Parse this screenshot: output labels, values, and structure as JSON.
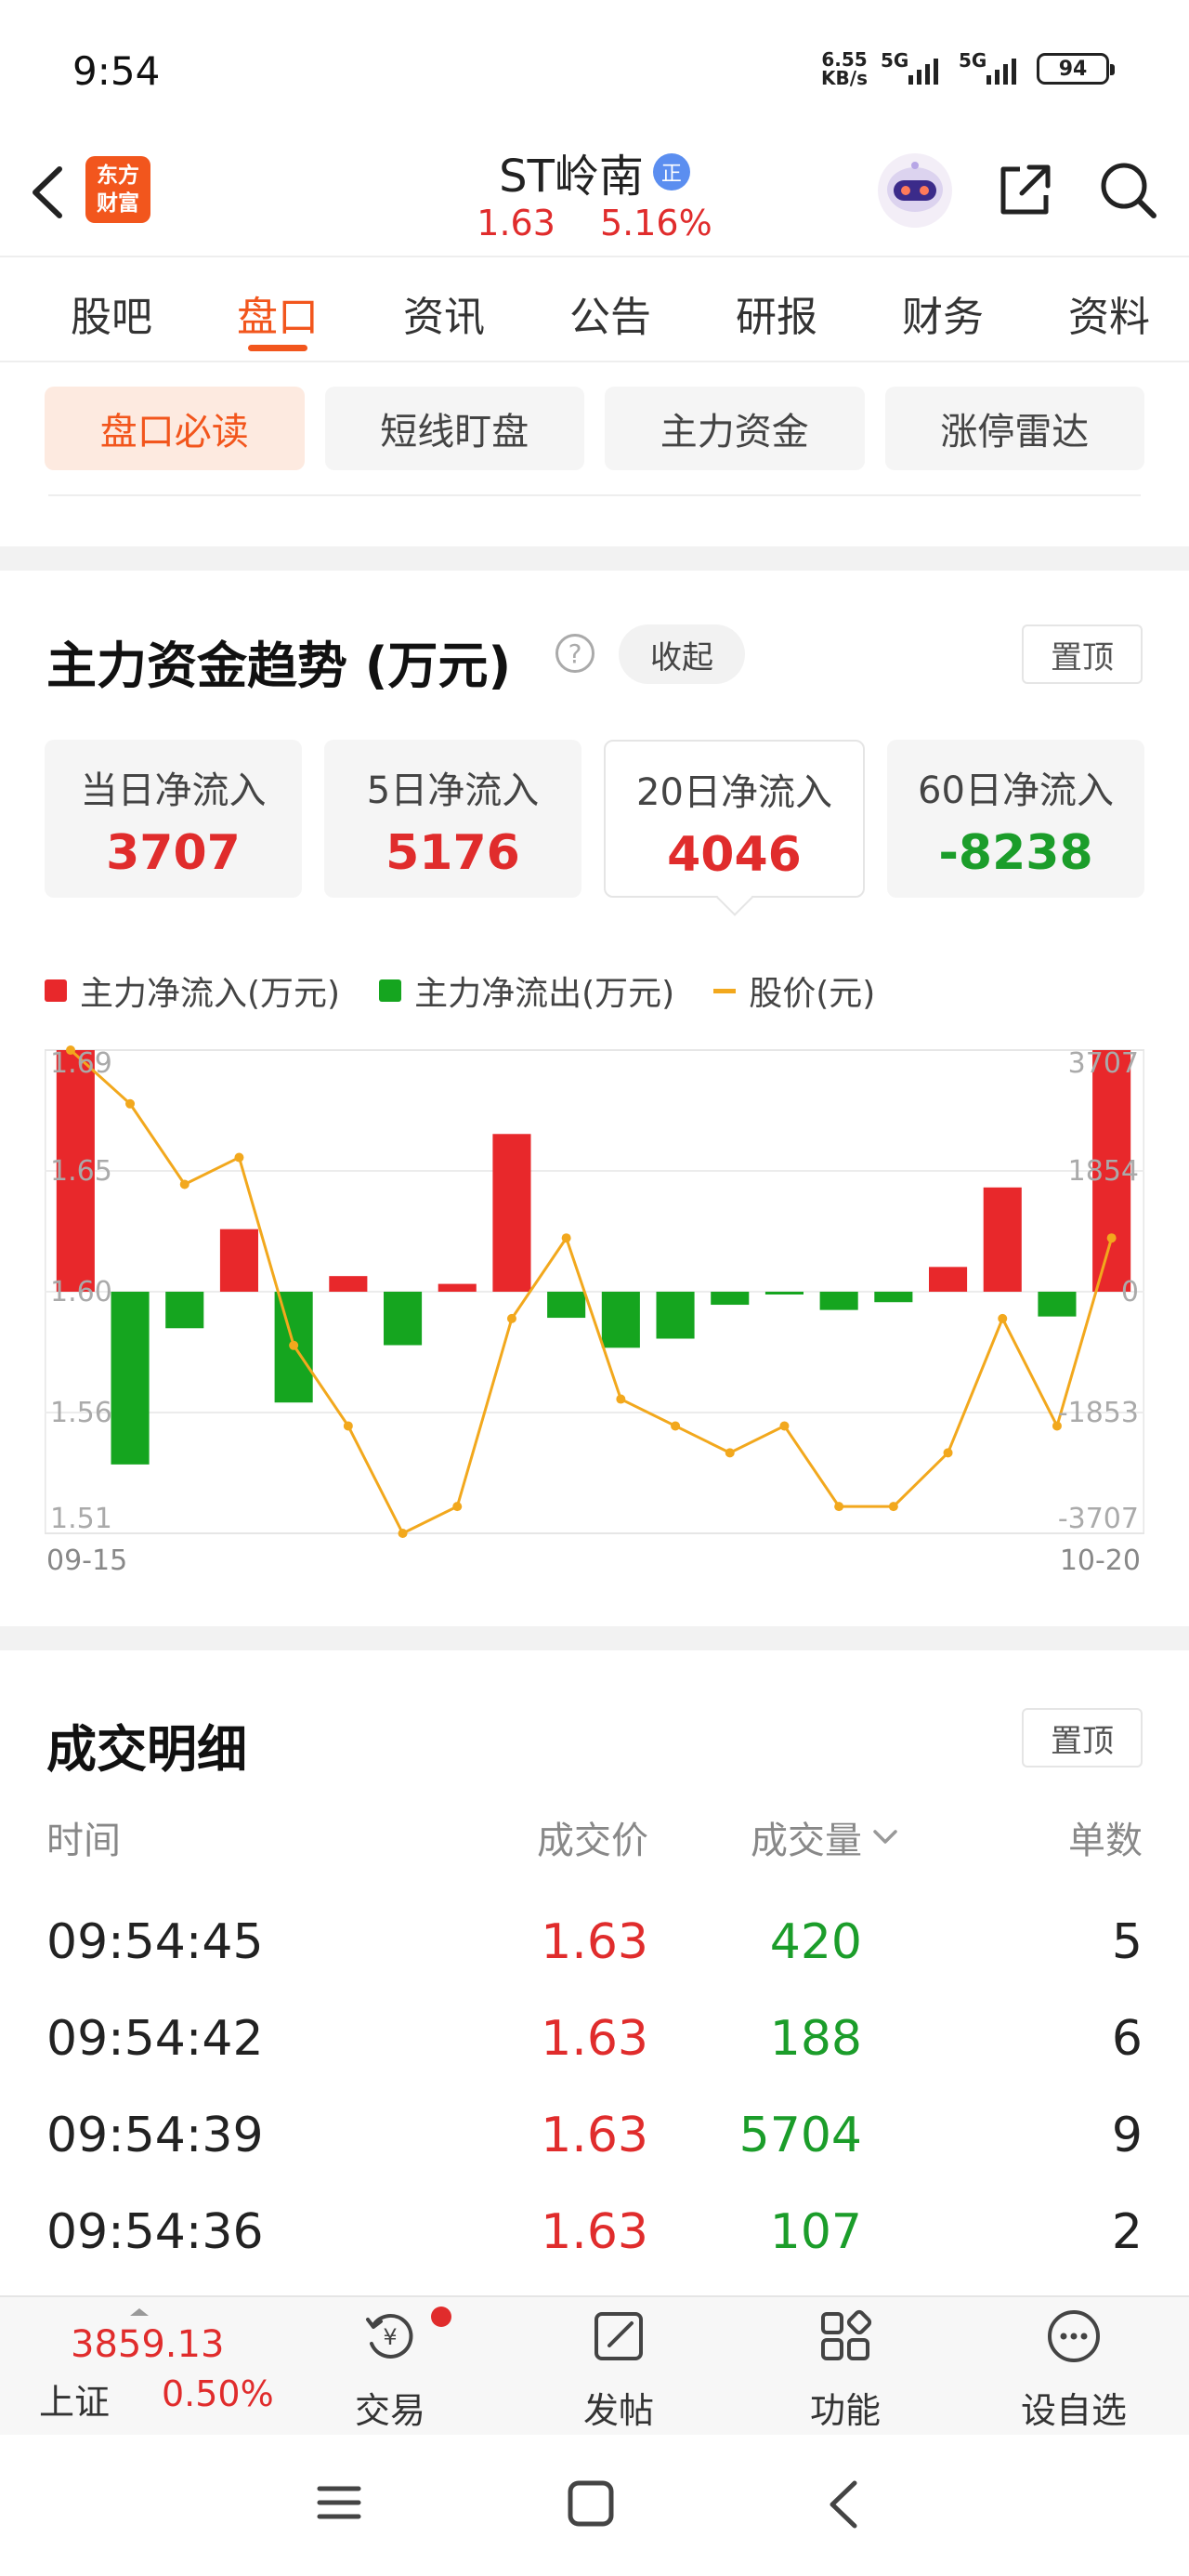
{
  "status_bar": {
    "time": "9:54",
    "net_speed_value": "6.55",
    "net_speed_unit": "KB/s",
    "signal1": "5G",
    "signal2": "5G",
    "battery": "94"
  },
  "header": {
    "logo_line1": "东方",
    "logo_line2": "财富",
    "stock_name": "ST岭南",
    "badge": "正",
    "price": "1.63",
    "change_pct": "5.16%"
  },
  "tabs": [
    "股吧",
    "盘口",
    "资讯",
    "公告",
    "研报",
    "财务",
    "资料"
  ],
  "active_tab": "盘口",
  "subtabs": [
    "盘口必读",
    "短线盯盘",
    "主力资金",
    "涨停雷达"
  ],
  "fund_trend": {
    "title": "主力资金趋势 (万元)",
    "collapse_label": "收起",
    "pin_label": "置顶",
    "cards": [
      {
        "label": "当日净流入",
        "value": "3707"
      },
      {
        "label": "5日净流入",
        "value": "5176"
      },
      {
        "label": "20日净流入",
        "value": "4046"
      },
      {
        "label": "60日净流入",
        "value": "-8238"
      }
    ],
    "legend": {
      "inflow": "主力净流入(万元)",
      "outflow": "主力净流出(万元)",
      "price": "股价(元)"
    },
    "x_start": "09-15",
    "x_end": "10-20"
  },
  "chart_data": {
    "type": "bar",
    "title": "",
    "x": [
      "09-15",
      "",
      "",
      "",
      "",
      "",
      "",
      "",
      "",
      "",
      "",
      "",
      "",
      "",
      "",
      "",
      "",
      "",
      "",
      "",
      "10-20"
    ],
    "series": [
      {
        "name": "主力净流入(万元)/主力净流出(万元)",
        "values": [
          3707,
          -2650,
          -560,
          960,
          -1700,
          240,
          -820,
          120,
          2420,
          -400,
          -860,
          -720,
          -200,
          -30,
          -280,
          -160,
          380,
          1600,
          -380,
          3707
        ]
      },
      {
        "name": "股价(元)",
        "type": "line",
        "values": [
          1.69,
          1.67,
          1.64,
          1.65,
          1.58,
          1.55,
          1.51,
          1.52,
          1.59,
          1.62,
          1.56,
          1.55,
          1.54,
          1.55,
          1.52,
          1.52,
          1.54,
          1.59,
          1.55,
          1.62
        ]
      }
    ],
    "left_axis_ticks": [
      "1.69",
      "1.65",
      "1.60",
      "1.56",
      "1.51"
    ],
    "right_axis_ticks": [
      "3707",
      "1854",
      "0",
      "-1853",
      "-3707"
    ],
    "ylim_left": [
      1.51,
      1.69
    ],
    "ylim_right": [
      -3707,
      3707
    ],
    "colors": {
      "inflow": "#e8282b",
      "outflow": "#15a51f",
      "price": "#f2a81d"
    }
  },
  "trade_detail": {
    "title": "成交明细",
    "pin_label": "置顶",
    "headers": {
      "time": "时间",
      "price": "成交价",
      "volume": "成交量",
      "count": "单数"
    },
    "rows": [
      {
        "time": "09:54:45",
        "price": "1.63",
        "volume": "420",
        "count": "5"
      },
      {
        "time": "09:54:42",
        "price": "1.63",
        "volume": "188",
        "count": "6"
      },
      {
        "time": "09:54:39",
        "price": "1.63",
        "volume": "5704",
        "count": "9"
      },
      {
        "time": "09:54:36",
        "price": "1.63",
        "volume": "107",
        "count": "2"
      }
    ]
  },
  "bottom_nav": {
    "index_value": "3859.13",
    "index_name": "上证",
    "index_change": "0.50%",
    "items": [
      "交易",
      "发帖",
      "功能",
      "设自选"
    ]
  }
}
